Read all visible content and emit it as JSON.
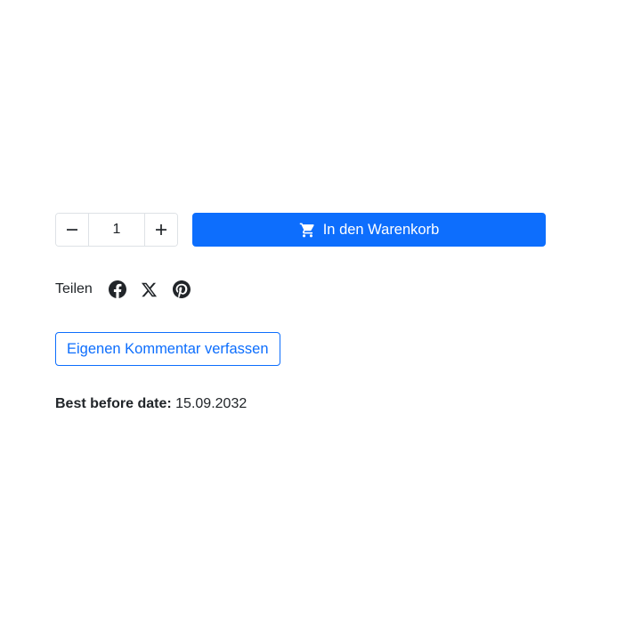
{
  "buy": {
    "quantity": "1",
    "decrease_icon": "minus-icon",
    "increase_icon": "plus-icon",
    "cart_icon": "shopping-cart-icon",
    "cart_label": "In den Warenkorb",
    "accent_color": "#0d6efd"
  },
  "share": {
    "label": "Teilen",
    "icons": [
      "facebook-icon",
      "x-twitter-icon",
      "pinterest-icon"
    ]
  },
  "comment": {
    "button_label": "Eigenen Kommentar verfassen"
  },
  "product": {
    "best_before_label": "Best before date:",
    "best_before_value": "15.09.2032"
  }
}
